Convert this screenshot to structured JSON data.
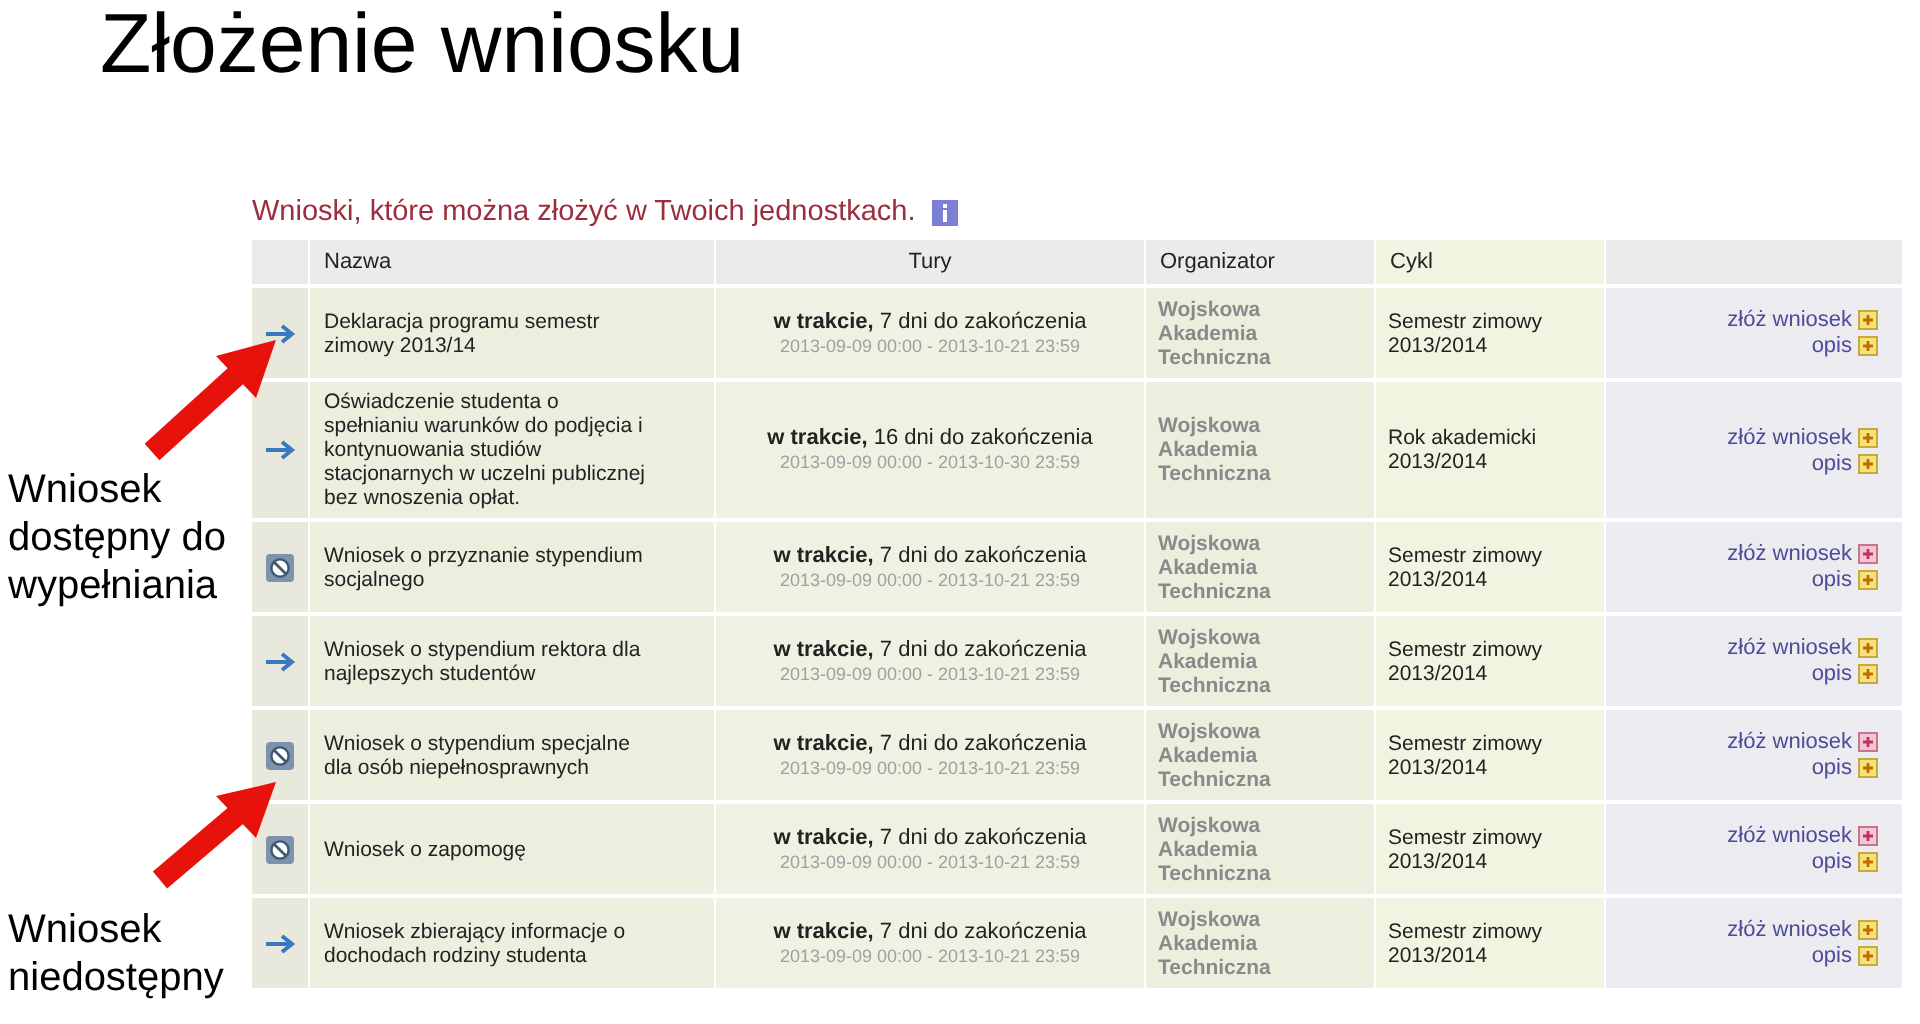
{
  "slide_title": "Złożenie wniosku",
  "callouts": [
    {
      "text": "Wniosek dostępny do wypełniania"
    },
    {
      "text": "Wniosek niedostępny"
    }
  ],
  "heading": "Wnioski, które można złożyć w Twoich jednostkach.",
  "table": {
    "columns": [
      "Nazwa",
      "Tury",
      "Organizator",
      "Cykl"
    ],
    "rows": [
      {
        "available": true,
        "name": "Deklaracja programu semestr zimowy 2013/14",
        "status": "**w trakcie,** 7 dni do zakończenia",
        "dates": "2013-09-09 00:00 - 2013-10-21 23:59",
        "organizer": "Wojskowa Akademia Techniczna",
        "cycle": "Semestr zimowy 2013/2014",
        "submit": "złóż wniosek",
        "info": "opis"
      },
      {
        "available": true,
        "name": "Oświadczenie studenta o spełnianiu warunków do podjęcia i kontynuowania studiów stacjonarnych w uczelni publicznej bez wnoszenia opłat.",
        "status": "**w trakcie,** 16 dni do zakończenia",
        "dates": "2013-09-09 00:00 - 2013-10-30 23:59",
        "organizer": "Wojskowa Akademia Techniczna",
        "cycle": "Rok akademicki 2013/2014",
        "submit": "złóż wniosek",
        "info": "opis"
      },
      {
        "available": false,
        "name": "Wniosek o przyznanie stypendium socjalnego",
        "status": "**w trakcie,** 7 dni do zakończenia",
        "dates": "2013-09-09 00:00 - 2013-10-21 23:59",
        "organizer": "Wojskowa Akademia Techniczna",
        "cycle": "Semestr zimowy 2013/2014",
        "submit": "złóż wniosek",
        "info": "opis"
      },
      {
        "available": true,
        "name": "Wniosek o stypendium rektora dla najlepszych studentów",
        "status": "**w trakcie,** 7 dni do zakończenia",
        "dates": "2013-09-09 00:00 - 2013-10-21 23:59",
        "organizer": "Wojskowa Akademia Techniczna",
        "cycle": "Semestr zimowy 2013/2014",
        "submit": "złóż wniosek",
        "info": "opis"
      },
      {
        "available": false,
        "name": "Wniosek o stypendium specjalne dla osób niepełnosprawnych",
        "status": "**w trakcie,** 7 dni do zakończenia",
        "dates": "2013-09-09 00:00 - 2013-10-21 23:59",
        "organizer": "Wojskowa Akademia Techniczna",
        "cycle": "Semestr zimowy 2013/2014",
        "submit": "złóż wniosek",
        "info": "opis"
      },
      {
        "available": false,
        "name": "Wniosek o zapomogę",
        "status": "**w trakcie,** 7 dni do zakończenia",
        "dates": "2013-09-09 00:00 - 2013-10-21 23:59",
        "organizer": "Wojskowa Akademia Techniczna",
        "cycle": "Semestr zimowy 2013/2014",
        "submit": "złóż wniosek",
        "info": "opis"
      },
      {
        "available": true,
        "name": "Wniosek zbierający informacje o dochodach rodziny studenta",
        "status": "**w trakcie,** 7 dni do zakończenia",
        "dates": "2013-09-09 00:00 - 2013-10-21 23:59",
        "organizer": "Wojskowa Akademia Techniczna",
        "cycle": "Semestr zimowy 2013/2014",
        "submit": "złóż wniosek",
        "info": "opis"
      }
    ]
  }
}
